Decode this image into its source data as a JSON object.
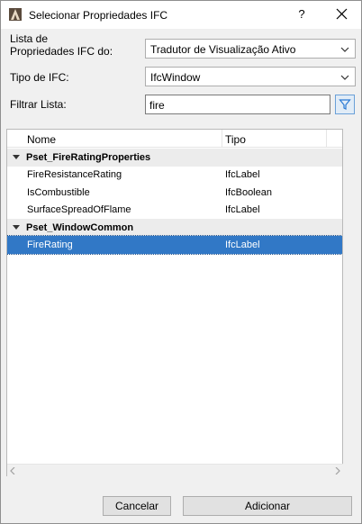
{
  "window": {
    "title": "Selecionar Propriedades IFC",
    "help_label": "?"
  },
  "form": {
    "list_label": "Lista de\nPropriedades IFC do:",
    "list_value": "Tradutor de Visualização Ativo",
    "type_label": "Tipo de IFC:",
    "type_value": "IfcWindow",
    "filter_label": "Filtrar Lista:",
    "filter_value": "fire"
  },
  "table": {
    "columns": [
      "Nome",
      "Tipo"
    ],
    "groups": [
      {
        "name": "Pset_FireRatingProperties",
        "rows": [
          {
            "name": "FireResistanceRating",
            "type": "IfcLabel"
          },
          {
            "name": "IsCombustible",
            "type": "IfcBoolean"
          },
          {
            "name": "SurfaceSpreadOfFlame",
            "type": "IfcLabel"
          }
        ]
      },
      {
        "name": "Pset_WindowCommon",
        "rows": [
          {
            "name": "FireRating",
            "type": "IfcLabel",
            "selected": true
          }
        ]
      }
    ]
  },
  "buttons": {
    "cancel": "Cancelar",
    "add": "Adicionar"
  },
  "colors": {
    "selection": "#3178c6",
    "filter_accent": "#2a7ad5"
  },
  "icons": {
    "app": "archicad-icon",
    "help": "help-icon",
    "close": "close-icon",
    "dropdown": "chevron-down-icon",
    "filter": "funnel-icon"
  }
}
